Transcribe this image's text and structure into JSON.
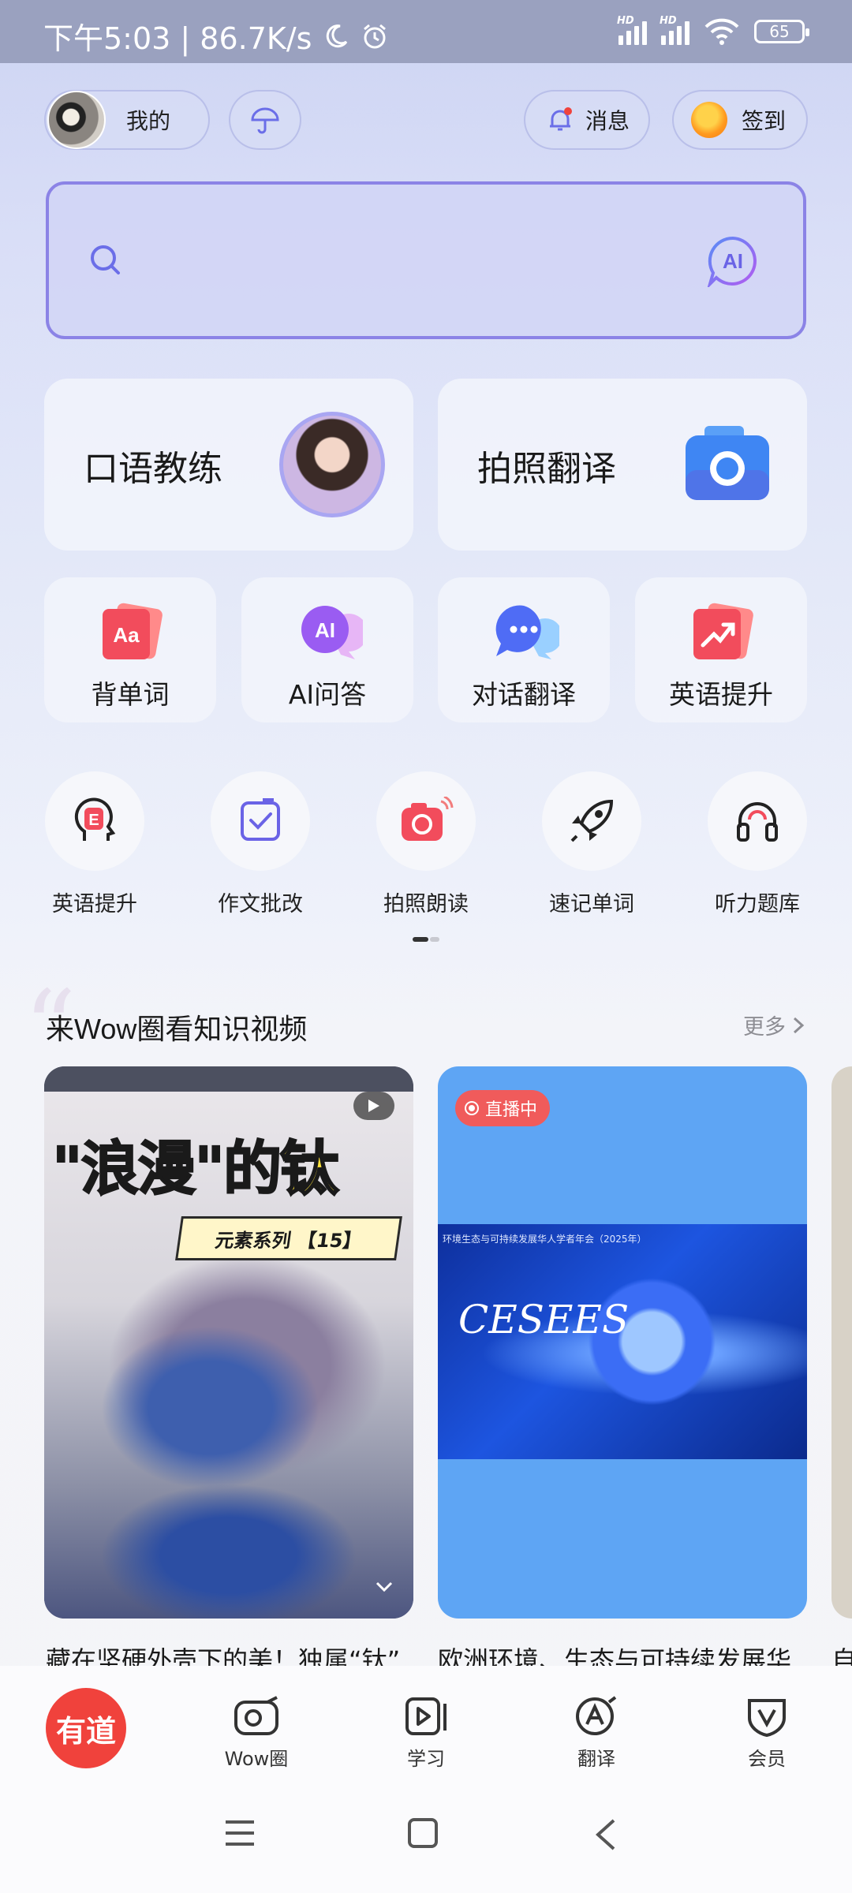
{
  "status_bar": {
    "time_speed": "下午5:03 | 86.7K/s",
    "battery": "65",
    "hd": "HD"
  },
  "header": {
    "me_label": "我的",
    "message_label": "消息",
    "signin_label": "签到"
  },
  "search": {
    "placeholder": "",
    "ai_label": "AI"
  },
  "big_cards": [
    {
      "label": "口语教练"
    },
    {
      "label": "拍照翻译"
    }
  ],
  "small_cards": [
    {
      "label": "背单词",
      "icon": "flashcard-icon",
      "color": "#f24c5c"
    },
    {
      "label": "AI问答",
      "icon": "ai-chat-icon",
      "color": "#9a5cf2"
    },
    {
      "label": "对话翻译",
      "icon": "chat-bubble-icon",
      "color": "#4f6cf5"
    },
    {
      "label": "英语提升",
      "icon": "trend-up-icon",
      "color": "#f24c5c"
    }
  ],
  "circle_tools": [
    {
      "label": "英语提升",
      "icon": "head-e-icon"
    },
    {
      "label": "作文批改",
      "icon": "check-square-icon"
    },
    {
      "label": "拍照朗读",
      "icon": "camera-sound-icon"
    },
    {
      "label": "速记单词",
      "icon": "rocket-icon"
    },
    {
      "label": "听力题库",
      "icon": "headphones-icon"
    }
  ],
  "section": {
    "title": "来Wow圈看知识视频",
    "more": "更多"
  },
  "videos": [
    {
      "title_part1": "\"浪漫\"的",
      "title_part2": "钛",
      "banner": "元素系列 【15】",
      "caption": "藏在坚硬外壳下的美！独属“钛”"
    },
    {
      "badge": "直播中",
      "poster_text": "CESEES",
      "poster_sub": "环境生态与可持续发展华人学者年会（2025年）",
      "caption": "欧洲环境、生态与可持续发展华"
    },
    {
      "caption": "自"
    }
  ],
  "tabbar": {
    "logo": "有道",
    "tabs": [
      "Wow圈",
      "学习",
      "翻译",
      "会员"
    ]
  },
  "colors": {
    "accent": "#8b83e6",
    "brand_red": "#f0423c",
    "live_red": "#f05b5b"
  }
}
